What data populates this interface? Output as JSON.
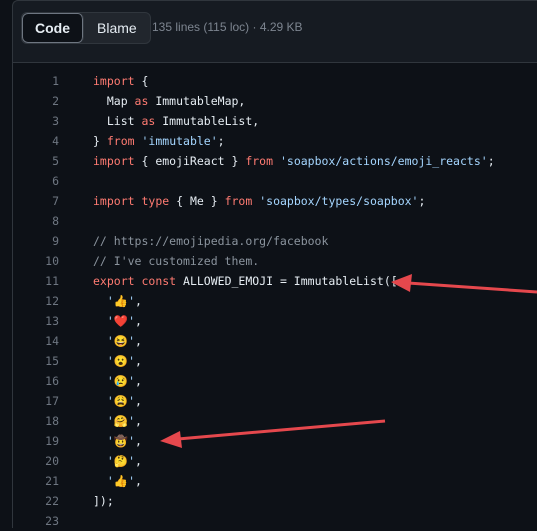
{
  "toolbar": {
    "code_label": "Code",
    "blame_label": "Blame",
    "file_info": "135 lines (115 loc) · 4.29 KB"
  },
  "lines": [
    {
      "n": "1",
      "tokens": [
        [
          "kw",
          "import"
        ],
        [
          "fn",
          " {"
        ]
      ]
    },
    {
      "n": "2",
      "tokens": [
        [
          "fn",
          "  Map "
        ],
        [
          "kw",
          "as"
        ],
        [
          "fn",
          " ImmutableMap,"
        ]
      ]
    },
    {
      "n": "3",
      "tokens": [
        [
          "fn",
          "  List "
        ],
        [
          "kw",
          "as"
        ],
        [
          "fn",
          " ImmutableList,"
        ]
      ]
    },
    {
      "n": "4",
      "tokens": [
        [
          "fn",
          "} "
        ],
        [
          "kw",
          "from"
        ],
        [
          "fn",
          " "
        ],
        [
          "str",
          "'immutable'"
        ],
        [
          "fn",
          ";"
        ]
      ]
    },
    {
      "n": "5",
      "tokens": [
        [
          "kw",
          "import"
        ],
        [
          "fn",
          " { emojiReact } "
        ],
        [
          "kw",
          "from"
        ],
        [
          "fn",
          " "
        ],
        [
          "str",
          "'soapbox/actions/emoji_reacts'"
        ],
        [
          "fn",
          ";"
        ]
      ]
    },
    {
      "n": "6",
      "tokens": []
    },
    {
      "n": "7",
      "tokens": [
        [
          "kw",
          "import"
        ],
        [
          "fn",
          " "
        ],
        [
          "kw",
          "type"
        ],
        [
          "fn",
          " { Me } "
        ],
        [
          "kw",
          "from"
        ],
        [
          "fn",
          " "
        ],
        [
          "str",
          "'soapbox/types/soapbox'"
        ],
        [
          "fn",
          ";"
        ]
      ]
    },
    {
      "n": "8",
      "tokens": []
    },
    {
      "n": "9",
      "tokens": [
        [
          "cm",
          "// https://emojipedia.org/facebook"
        ]
      ]
    },
    {
      "n": "10",
      "tokens": [
        [
          "cm",
          "// I've customized them."
        ]
      ]
    },
    {
      "n": "11",
      "tokens": [
        [
          "kw",
          "export"
        ],
        [
          "fn",
          " "
        ],
        [
          "kw",
          "const"
        ],
        [
          "fn",
          " ALLOWED_EMOJI = ImmutableList(["
        ]
      ]
    },
    {
      "n": "12",
      "tokens": [
        [
          "str",
          "  '👍'"
        ],
        [
          "fn",
          ","
        ]
      ]
    },
    {
      "n": "13",
      "tokens": [
        [
          "str",
          "  '❤️'"
        ],
        [
          "fn",
          ","
        ]
      ]
    },
    {
      "n": "14",
      "tokens": [
        [
          "str",
          "  '😆'"
        ],
        [
          "fn",
          ","
        ]
      ]
    },
    {
      "n": "15",
      "tokens": [
        [
          "str",
          "  '😮'"
        ],
        [
          "fn",
          ","
        ]
      ]
    },
    {
      "n": "16",
      "tokens": [
        [
          "str",
          "  '😢'"
        ],
        [
          "fn",
          ","
        ]
      ]
    },
    {
      "n": "17",
      "tokens": [
        [
          "str",
          "  '😩'"
        ],
        [
          "fn",
          ","
        ]
      ]
    },
    {
      "n": "18",
      "tokens": [
        [
          "str",
          "  '🤗'"
        ],
        [
          "fn",
          ","
        ]
      ]
    },
    {
      "n": "19",
      "tokens": [
        [
          "str",
          "  '🤠'"
        ],
        [
          "fn",
          ","
        ]
      ]
    },
    {
      "n": "20",
      "tokens": [
        [
          "str",
          "  '🤔'"
        ],
        [
          "fn",
          ","
        ]
      ]
    },
    {
      "n": "21",
      "tokens": [
        [
          "str",
          "  '👍'"
        ],
        [
          "fn",
          ","
        ]
      ]
    },
    {
      "n": "22",
      "tokens": [
        [
          "fn",
          "]);"
        ]
      ]
    },
    {
      "n": "23",
      "tokens": []
    }
  ],
  "annotation_color": "#e5484d"
}
